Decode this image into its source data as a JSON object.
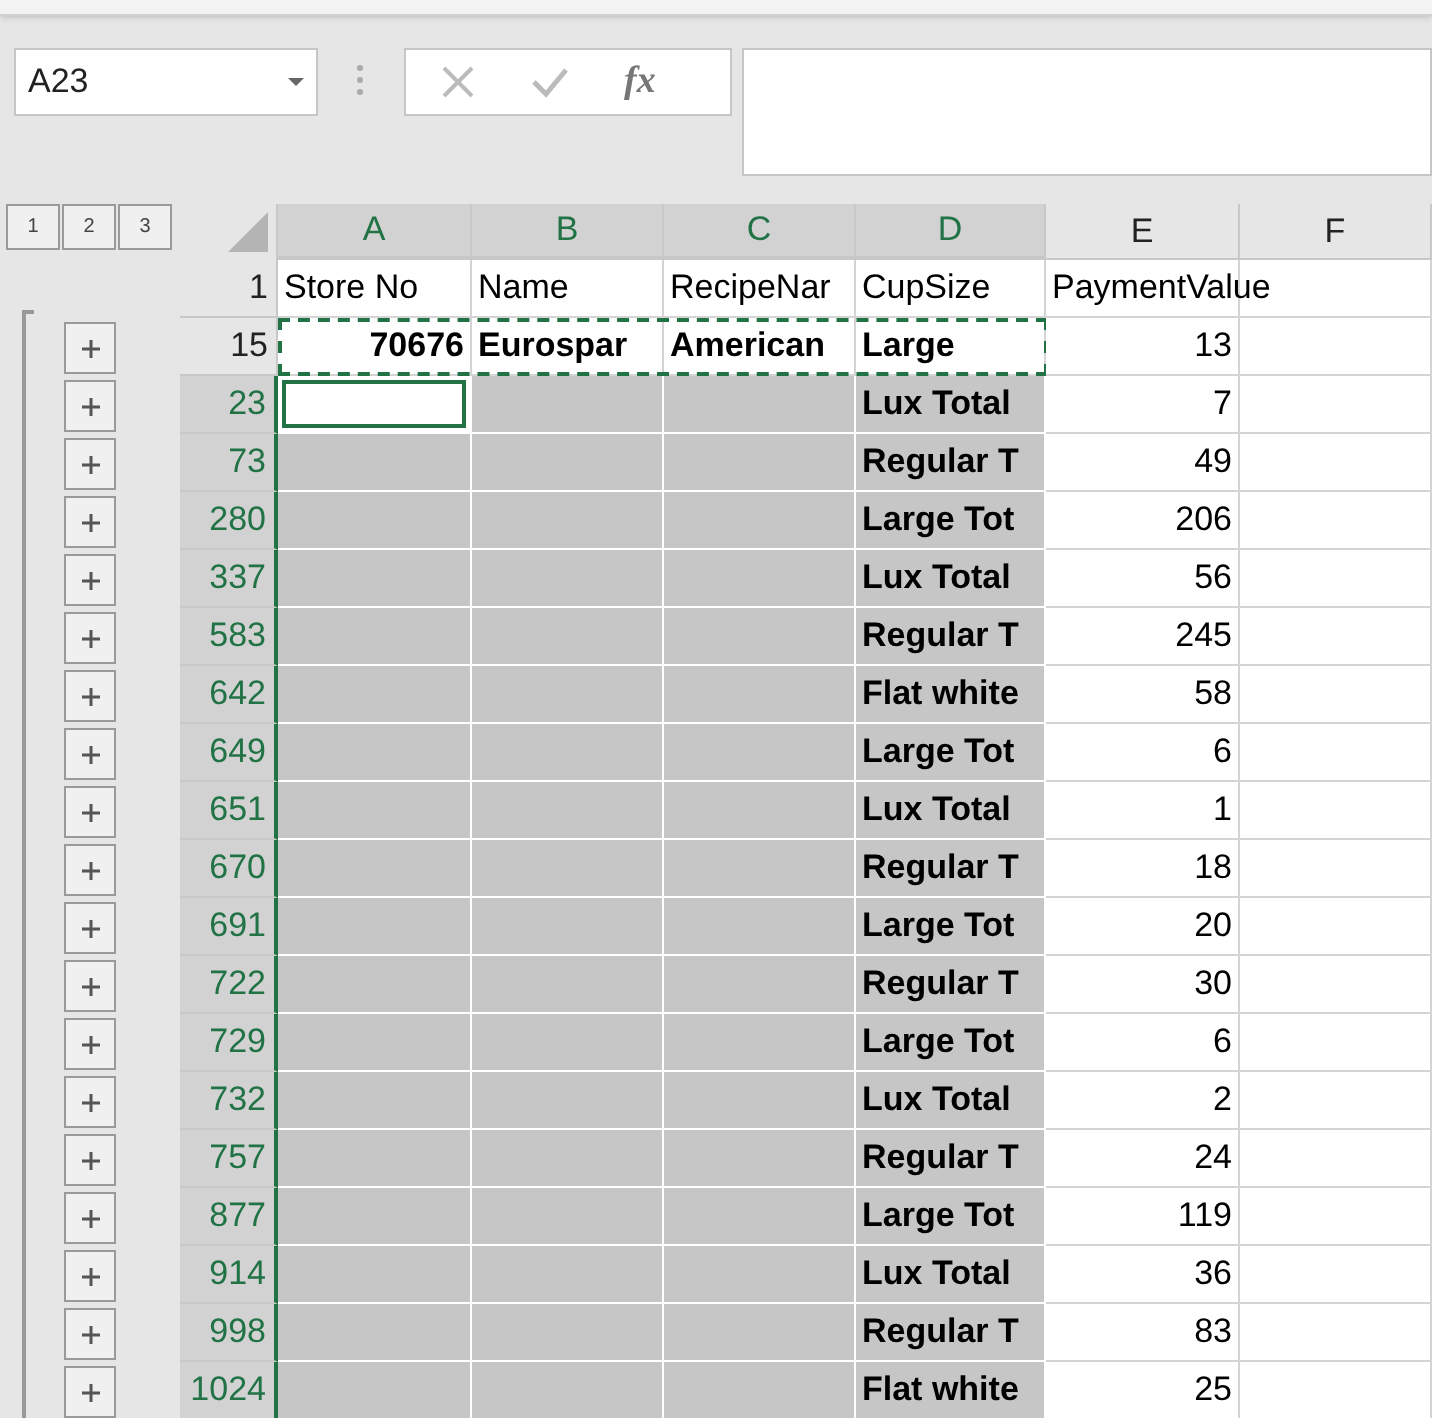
{
  "name_box": {
    "value": "A23"
  },
  "formula_bar": {
    "fx_label": "fx"
  },
  "outline_levels": [
    {
      "label": "1"
    },
    {
      "label": "2"
    },
    {
      "label": "3"
    }
  ],
  "columns": [
    {
      "label": "A",
      "selected": true
    },
    {
      "label": "B",
      "selected": true
    },
    {
      "label": "C",
      "selected": true
    },
    {
      "label": "D",
      "selected": true
    },
    {
      "label": "E",
      "selected": false
    },
    {
      "label": "F",
      "selected": false
    }
  ],
  "rows": [
    {
      "row": "1",
      "kind": "header",
      "selected": false,
      "copied": false,
      "active": false,
      "cells": [
        "Store No",
        "Name",
        "RecipeNar",
        "CupSize",
        "PaymentValue",
        ""
      ]
    },
    {
      "row": "15",
      "kind": "data",
      "selected": false,
      "copied": true,
      "active": false,
      "cells": [
        "70676",
        "Eurospar",
        "American",
        "Large",
        "13",
        ""
      ]
    },
    {
      "row": "23",
      "kind": "subtotal",
      "selected": true,
      "copied": false,
      "active": true,
      "cells": [
        "",
        "",
        "",
        "Lux Total",
        "7",
        ""
      ]
    },
    {
      "row": "73",
      "kind": "subtotal",
      "selected": true,
      "copied": false,
      "active": false,
      "cells": [
        "",
        "",
        "",
        "Regular T",
        "49",
        ""
      ]
    },
    {
      "row": "280",
      "kind": "subtotal",
      "selected": true,
      "copied": false,
      "active": false,
      "cells": [
        "",
        "",
        "",
        "Large Tot",
        "206",
        ""
      ]
    },
    {
      "row": "337",
      "kind": "subtotal",
      "selected": true,
      "copied": false,
      "active": false,
      "cells": [
        "",
        "",
        "",
        "Lux Total",
        "56",
        ""
      ]
    },
    {
      "row": "583",
      "kind": "subtotal",
      "selected": true,
      "copied": false,
      "active": false,
      "cells": [
        "",
        "",
        "",
        "Regular T",
        "245",
        ""
      ]
    },
    {
      "row": "642",
      "kind": "subtotal",
      "selected": true,
      "copied": false,
      "active": false,
      "cells": [
        "",
        "",
        "",
        "Flat white",
        "58",
        ""
      ]
    },
    {
      "row": "649",
      "kind": "subtotal",
      "selected": true,
      "copied": false,
      "active": false,
      "cells": [
        "",
        "",
        "",
        "Large Tot",
        "6",
        ""
      ]
    },
    {
      "row": "651",
      "kind": "subtotal",
      "selected": true,
      "copied": false,
      "active": false,
      "cells": [
        "",
        "",
        "",
        "Lux Total",
        "1",
        ""
      ]
    },
    {
      "row": "670",
      "kind": "subtotal",
      "selected": true,
      "copied": false,
      "active": false,
      "cells": [
        "",
        "",
        "",
        "Regular T",
        "18",
        ""
      ]
    },
    {
      "row": "691",
      "kind": "subtotal",
      "selected": true,
      "copied": false,
      "active": false,
      "cells": [
        "",
        "",
        "",
        "Large Tot",
        "20",
        ""
      ]
    },
    {
      "row": "722",
      "kind": "subtotal",
      "selected": true,
      "copied": false,
      "active": false,
      "cells": [
        "",
        "",
        "",
        "Regular T",
        "30",
        ""
      ]
    },
    {
      "row": "729",
      "kind": "subtotal",
      "selected": true,
      "copied": false,
      "active": false,
      "cells": [
        "",
        "",
        "",
        "Large Tot",
        "6",
        ""
      ]
    },
    {
      "row": "732",
      "kind": "subtotal",
      "selected": true,
      "copied": false,
      "active": false,
      "cells": [
        "",
        "",
        "",
        "Lux Total",
        "2",
        ""
      ]
    },
    {
      "row": "757",
      "kind": "subtotal",
      "selected": true,
      "copied": false,
      "active": false,
      "cells": [
        "",
        "",
        "",
        "Regular T",
        "24",
        ""
      ]
    },
    {
      "row": "877",
      "kind": "subtotal",
      "selected": true,
      "copied": false,
      "active": false,
      "cells": [
        "",
        "",
        "",
        "Large Tot",
        "119",
        ""
      ]
    },
    {
      "row": "914",
      "kind": "subtotal",
      "selected": true,
      "copied": false,
      "active": false,
      "cells": [
        "",
        "",
        "",
        "Lux Total",
        "36",
        ""
      ]
    },
    {
      "row": "998",
      "kind": "subtotal",
      "selected": true,
      "copied": false,
      "active": false,
      "cells": [
        "",
        "",
        "",
        "Regular T",
        "83",
        ""
      ]
    },
    {
      "row": "1024",
      "kind": "subtotal",
      "selected": true,
      "copied": false,
      "active": false,
      "cells": [
        "",
        "",
        "",
        "Flat white",
        "25",
        ""
      ]
    }
  ]
}
